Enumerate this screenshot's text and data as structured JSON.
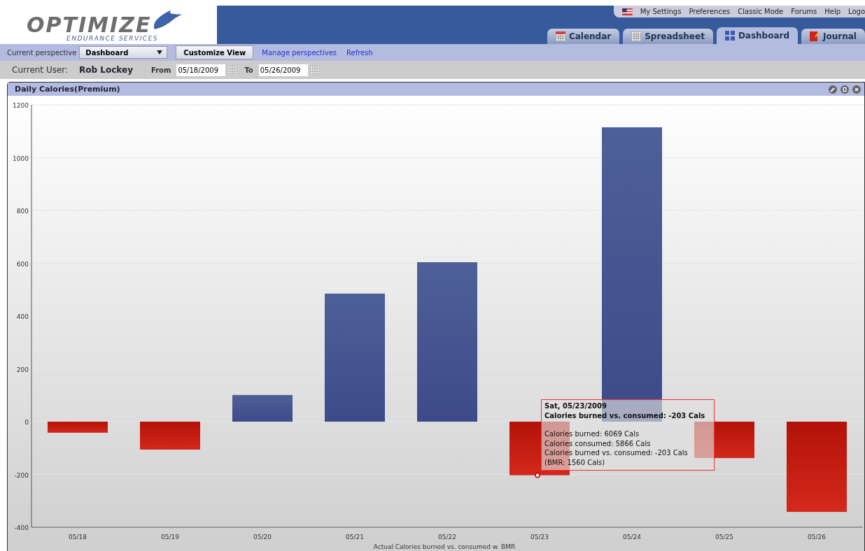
{
  "header": {
    "logo": {
      "name": "OPTIMIZE",
      "tagline": "ENDURANCE SERVICES"
    },
    "top_links": [
      "My Settings",
      "Preferences",
      "Classic Mode",
      "Forums",
      "Help",
      "Logo"
    ],
    "tabs": [
      {
        "label": "Calendar",
        "kind": "calendar",
        "selected": false
      },
      {
        "label": "Spreadsheet",
        "kind": "spreadsheet",
        "selected": false
      },
      {
        "label": "Dashboard",
        "kind": "dashboard",
        "selected": true
      },
      {
        "label": "Journal",
        "kind": "journal",
        "selected": false
      }
    ]
  },
  "perspective_bar": {
    "label": "Current perspective",
    "perspective": "Dashboard",
    "customize_button": "Customize View",
    "links": [
      "Manage perspectives",
      "Refresh"
    ]
  },
  "user_bar": {
    "label": "Current User:",
    "user": "Rob  Lockey",
    "from_label": "From",
    "from": "05/18/2009",
    "to_label": "To",
    "to": "05/26/2009"
  },
  "panel": {
    "title": "Daily Calories(Premium)",
    "chart_data": {
      "type": "bar",
      "grid": true,
      "xlabel": "Actual Calories burned vs. consumed w. BMR",
      "categories": [
        "05/18",
        "05/19",
        "05/20",
        "05/21",
        "05/22",
        "05/23",
        "05/24",
        "05/25",
        "05/26"
      ],
      "values": [
        -42,
        -106,
        101,
        485,
        604,
        -203,
        1115,
        -138,
        -342
      ],
      "ylim": [
        -400,
        1200
      ],
      "yticks": [
        -400,
        -200,
        0,
        200,
        400,
        600,
        800,
        1000,
        1200
      ]
    },
    "tooltip": {
      "title": "Sat, 05/23/2009",
      "headline": "Calories burned vs. consumed: -203 Cals",
      "lines": [
        "Calories burned: 6069 Cals",
        "Calories consumed: 5866 Cals",
        "Calories burned vs. consumed: -203 Cals",
        "(BMR: 1560 Cals)"
      ]
    }
  }
}
